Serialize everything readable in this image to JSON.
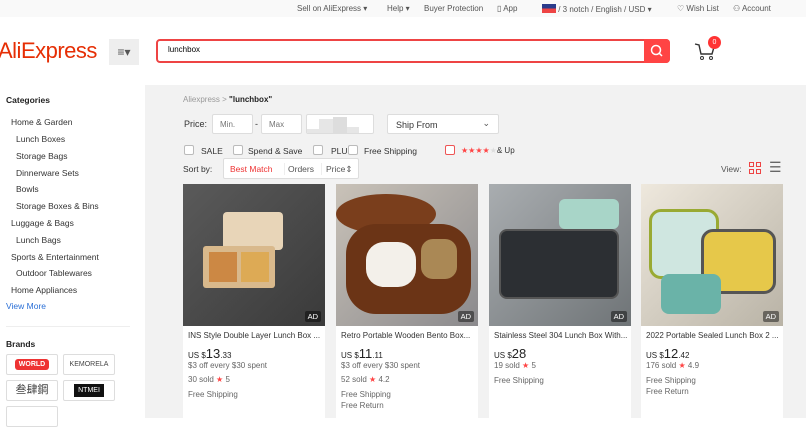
{
  "topbar": {
    "sell": "Sell on AliExpress",
    "help": "Help",
    "protection": "Buyer Protection",
    "app": "App",
    "locale": "/ 3 notch / English /  USD",
    "wishlist": "Wish List",
    "account": "Account"
  },
  "header": {
    "logo": "AliExpress",
    "search_value": "lunchbox",
    "cart_count": "0"
  },
  "sidebar": {
    "categories_title": "Categories",
    "categories": [
      {
        "label": "Home & Garden",
        "level": 1
      },
      {
        "label": "Lunch Boxes",
        "level": 2
      },
      {
        "label": "Storage Bags",
        "level": 2
      },
      {
        "label": "Dinnerware Sets",
        "level": 2
      },
      {
        "label": "Bowls",
        "level": 2
      },
      {
        "label": "Storage Boxes & Bins",
        "level": 2
      },
      {
        "label": "Luggage & Bags",
        "level": 1
      },
      {
        "label": "Lunch Bags",
        "level": 2
      },
      {
        "label": "Sports & Entertainment",
        "level": 1
      },
      {
        "label": "Outdoor Tablewares",
        "level": 2
      },
      {
        "label": "Home Appliances",
        "level": 1
      }
    ],
    "view_more": "View More",
    "brands_title": "Brands",
    "brands": [
      "WORLD",
      "KEMORELA",
      "叁肆鋼",
      "NTMEI"
    ]
  },
  "main": {
    "breadcrumb_root": "Aliexpress",
    "breadcrumb_sep": ">",
    "breadcrumb_current": "\"lunchbox\"",
    "price_label": "Price:",
    "min_placeholder": "Min.",
    "max_placeholder": "Max",
    "dash": "-",
    "ship_from": "Ship From",
    "filters": [
      "SALE",
      "Spend & Save",
      "PLUS",
      "Free Shipping"
    ],
    "rating_filter": "& Up",
    "rating_stars": "★★★★",
    "rating_empty_star": "★",
    "sort_label": "Sort by:",
    "sort_options": [
      "Best Match",
      "Orders",
      "Price"
    ],
    "view_label": "View:"
  },
  "products": [
    {
      "title": "INS Style Double Layer Lunch Box ...",
      "currency": "US $",
      "price_int": "13",
      "price_dec": ".33",
      "promo": "$3 off every $30 spent",
      "sold": "30 sold",
      "rating": "5",
      "shipping": "Free Shipping",
      "ret": "",
      "ad": "AD"
    },
    {
      "title": "Retro Portable Wooden Bento Box...",
      "currency": "US $",
      "price_int": "11",
      "price_dec": ".11",
      "promo": "$3 off every $30 spent",
      "sold": "52 sold",
      "rating": "4.2",
      "shipping": "Free Shipping",
      "ret": "Free Return",
      "ad": "AD"
    },
    {
      "title": "Stainless Steel 304 Lunch Box With...",
      "currency": "US $",
      "price_int": "28",
      "price_dec": "",
      "promo": "",
      "sold": "19 sold",
      "rating": "5",
      "shipping": "Free Shipping",
      "ret": "",
      "ad": "AD"
    },
    {
      "title": "2022 Portable Sealed Lunch Box 2 ...",
      "currency": "US $",
      "price_int": "12",
      "price_dec": ".42",
      "promo": "",
      "sold": "176 sold",
      "rating": "4.9",
      "shipping": "Free Shipping",
      "ret": "Free Return",
      "ad": "AD"
    }
  ]
}
